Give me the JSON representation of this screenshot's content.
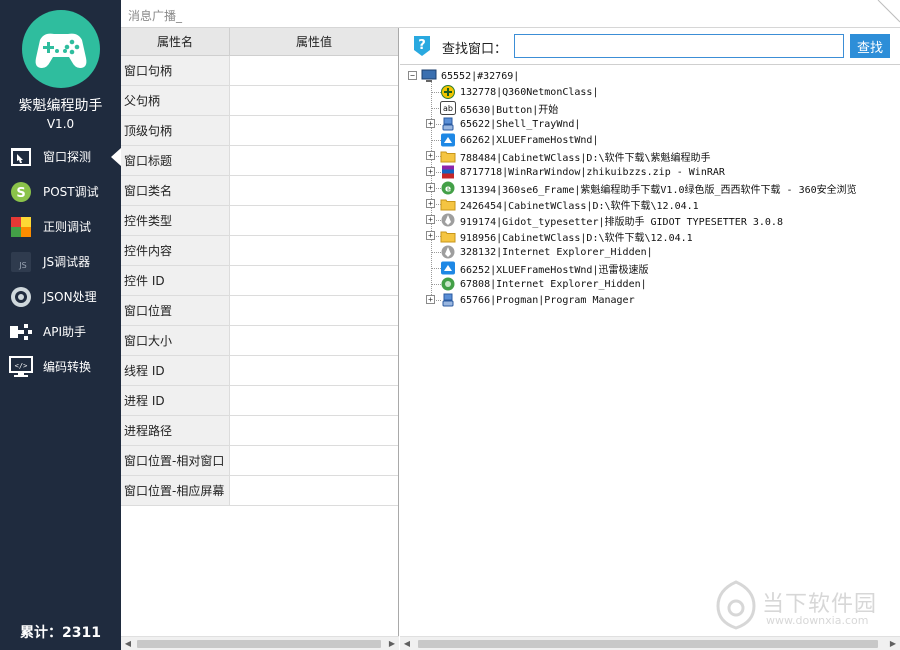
{
  "app": {
    "name": "紫魁编程助手",
    "version": "V1.0",
    "total": "累计：2311"
  },
  "nav": [
    {
      "label": "窗口探测",
      "icon": "window-probe-icon",
      "active": true
    },
    {
      "label": "POST调试",
      "icon": "post-debug-icon",
      "active": false
    },
    {
      "label": "正则调试",
      "icon": "regex-icon",
      "active": false
    },
    {
      "label": "JS调试器",
      "icon": "js-icon",
      "active": false
    },
    {
      "label": "JSON处理",
      "icon": "json-icon",
      "active": false
    },
    {
      "label": "API助手",
      "icon": "api-icon",
      "active": false
    },
    {
      "label": "编码转换",
      "icon": "encode-icon",
      "active": false
    }
  ],
  "message_bar": {
    "text": "消息广播_"
  },
  "props": {
    "headers": [
      "属性名",
      "属性值"
    ],
    "rows": [
      {
        "name": "窗口句柄",
        "value": ""
      },
      {
        "name": "父句柄",
        "value": ""
      },
      {
        "name": "顶级句柄",
        "value": ""
      },
      {
        "name": "窗口标题",
        "value": ""
      },
      {
        "name": "窗口类名",
        "value": ""
      },
      {
        "name": "控件类型",
        "value": ""
      },
      {
        "name": "控件内容",
        "value": ""
      },
      {
        "name": "控件 ID",
        "value": ""
      },
      {
        "name": "窗口位置",
        "value": ""
      },
      {
        "name": "窗口大小",
        "value": ""
      },
      {
        "name": "线程 ID",
        "value": ""
      },
      {
        "name": "进程 ID",
        "value": ""
      },
      {
        "name": "进程路径",
        "value": ""
      },
      {
        "name": "窗口位置-相对窗口",
        "value": ""
      },
      {
        "name": "窗口位置-相应屏幕",
        "value": ""
      }
    ]
  },
  "search": {
    "label": "查找窗口：",
    "value": "",
    "button": "查找"
  },
  "tree": {
    "root": "65552|#32769|",
    "children": [
      {
        "text": "132778|Q360NetmonClass|",
        "icon": "add-green-icon",
        "expandable": false
      },
      {
        "text": "65630|Button|开始",
        "icon": "ab-icon",
        "expandable": false
      },
      {
        "text": "65622|Shell_TrayWnd|",
        "icon": "computer-icon",
        "expandable": true
      },
      {
        "text": "66262|XLUEFrameHostWnd|",
        "icon": "blue-app-icon",
        "expandable": false
      },
      {
        "text": "788484|CabinetWClass|D:\\软件下载\\紫魁编程助手",
        "icon": "folder-icon",
        "expandable": true
      },
      {
        "text": "8717718|WinRarWindow|zhikuibzzs.zip - WinRAR",
        "icon": "winrar-icon",
        "expandable": true
      },
      {
        "text": "131394|360se6_Frame|紫魁编程助手下载V1.0绿色版_西西软件下载 - 360安全浏览",
        "icon": "browser-360-icon",
        "expandable": true
      },
      {
        "text": "2426454|CabinetWClass|D:\\软件下载\\12.04.1",
        "icon": "folder-icon",
        "expandable": true
      },
      {
        "text": "919174|Gidot_typesetter|排版助手 GIDOT TYPESETTER 3.0.8",
        "icon": "typesetter-icon",
        "expandable": true
      },
      {
        "text": "918956|CabinetWClass|D:\\软件下载\\12.04.1",
        "icon": "folder-icon",
        "expandable": true
      },
      {
        "text": "328132|Internet Explorer_Hidden|",
        "icon": "typesetter-icon",
        "expandable": false
      },
      {
        "text": "66252|XLUEFrameHostWnd|迅雷极速版",
        "icon": "blue-app-icon",
        "expandable": false
      },
      {
        "text": "67808|Internet Explorer_Hidden|",
        "icon": "ie-green-icon",
        "expandable": false
      },
      {
        "text": "65766|Progman|Program Manager",
        "icon": "computer-icon",
        "expandable": true
      }
    ]
  },
  "watermark": {
    "text": "当下软件园",
    "url": "www.downxia.com"
  },
  "colors": {
    "sidebar": "#1f2b3e",
    "logo": "#2fbd9e",
    "accent": "#2d8ed8"
  }
}
